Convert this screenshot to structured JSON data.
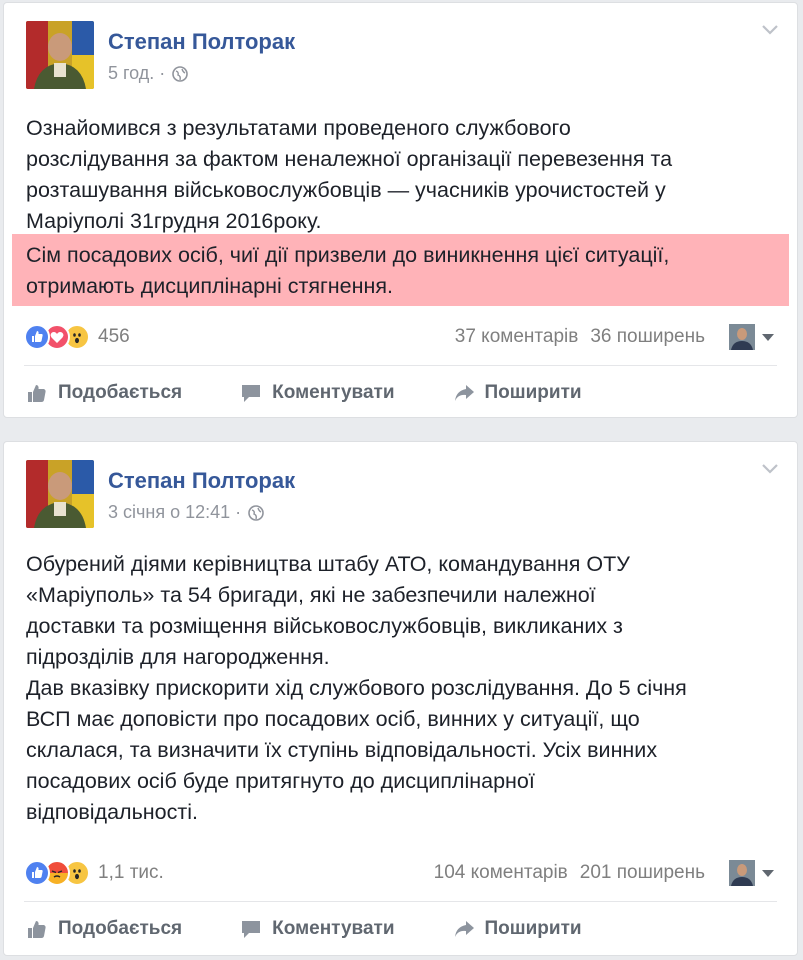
{
  "posts": [
    {
      "author": "Степан Полторак",
      "time": "5 год. ·",
      "text": "Ознайомився з результатами проведеного службового\nрозслідування за фактом неналежної організації перевезення та\nрозташування військовослужбовців — учасників урочистостей у\nМаріуполі 31грудня 2016року.",
      "highlight_text": "Сім посадових осіб, чиї дії призвели до виникнення цієї ситуації,\nотримають дисциплінарні стягнення.",
      "reactions": [
        "like",
        "love",
        "wow"
      ],
      "reaction_count": "456",
      "comments": "37 коментарів",
      "shares": "36 поширень"
    },
    {
      "author": "Степан Полторак",
      "time": "3 січня о 12:41 ·",
      "text": "Обурений діями керівництва штабу АТО, командування ОТУ\n«Маріуполь» та 54 бригади, які не забезпечили належної\nдоставки та розміщення військовослужбовців, викликаних з\nпідрозділів для нагородження.\nДав вказівку прискорити хід службового розслідування. До 5 січня\nВСП має доповісти про посадових осіб, винних у ситуації, що\nсклалася, та визначити їх ступінь відповідальності. Усіх винних\nпосадових осіб буде притягнуто до дисциплінарної\nвідповідальності.",
      "reactions": [
        "like",
        "angry",
        "wow"
      ],
      "reaction_count": "1,1 тис.",
      "comments": "104 коментарів",
      "shares": "201 поширень"
    }
  ],
  "actions": {
    "like": "Подобається",
    "comment": "Коментувати",
    "share": "Поширити"
  },
  "colors": {
    "author": "#365899",
    "highlight": "#ffb3b8",
    "muted": "#90949c"
  }
}
